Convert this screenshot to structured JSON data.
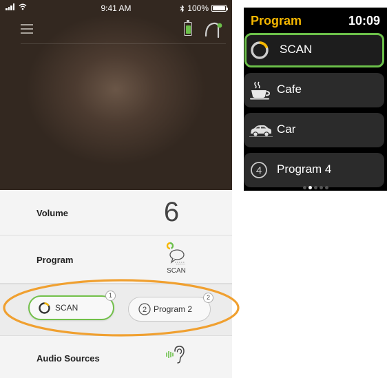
{
  "phone": {
    "status_bar": {
      "time": "9:41 AM",
      "battery_text": "100%",
      "battery_level": 1.0
    },
    "hearing_aid_battery_level": 0.85,
    "volume": {
      "label": "Volume",
      "value": "6"
    },
    "program": {
      "label": "Program",
      "value": "SCAN"
    },
    "program_chips": [
      {
        "label": "SCAN",
        "number": "1",
        "icon": "scan-ring-icon",
        "selected": true
      },
      {
        "label": "Program 2",
        "number": "2",
        "icon": "numbered-circle-icon",
        "icon_text": "2",
        "selected": false
      }
    ],
    "audio_sources": {
      "label": "Audio Sources"
    }
  },
  "watch": {
    "title": "Program",
    "time": "10:09",
    "items": [
      {
        "label": "SCAN",
        "icon": "scan-ring-icon",
        "selected": true
      },
      {
        "label": "Cafe",
        "icon": "coffee-cup-icon",
        "selected": false
      },
      {
        "label": "Car",
        "icon": "car-icon",
        "selected": false
      },
      {
        "label": "Program 4",
        "icon": "numbered-circle-icon",
        "icon_text": "4",
        "selected": false
      }
    ],
    "page_dots": {
      "count": 5,
      "active": 2
    }
  },
  "colors": {
    "accent_green": "#6cc04a",
    "watch_title": "#f5b700",
    "highlight_orange": "#f0a030",
    "hero_brown": "#4c3b30"
  }
}
